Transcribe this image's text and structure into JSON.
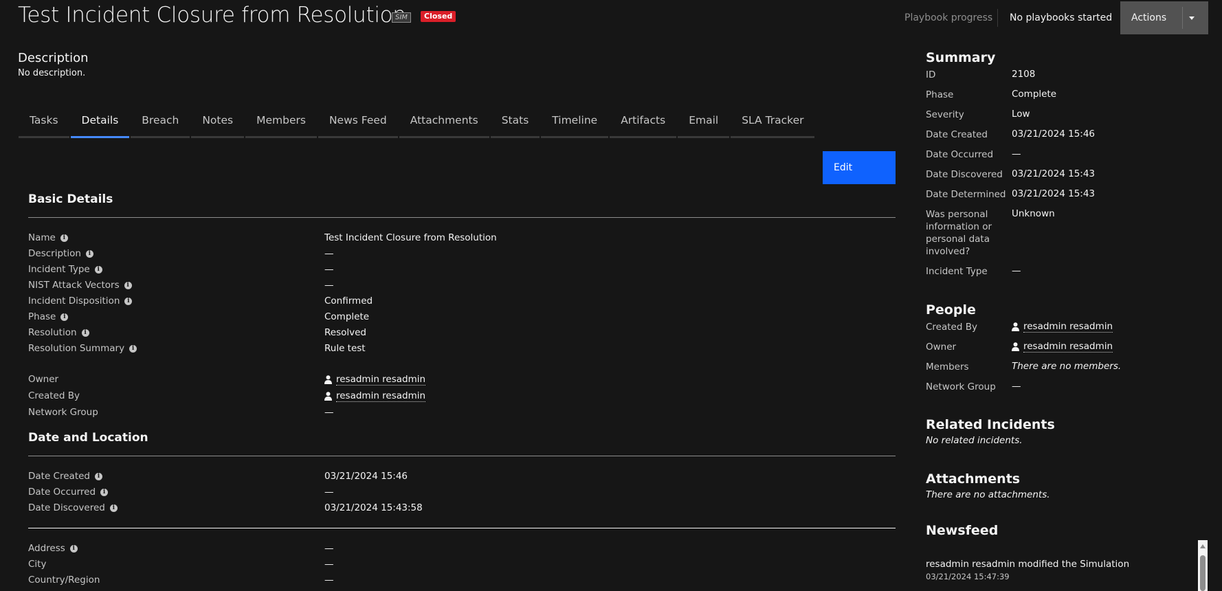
{
  "header": {
    "title": "Test Incident Closure from Resolution",
    "sim_badge": "SIM",
    "status_badge": "Closed",
    "playbook_label": "Playbook progress",
    "playbook_status": "No playbooks started",
    "actions_label": "Actions"
  },
  "description": {
    "heading": "Description",
    "value": "No description."
  },
  "tabs": [
    "Tasks",
    "Details",
    "Breach",
    "Notes",
    "Members",
    "News Feed",
    "Attachments",
    "Stats",
    "Timeline",
    "Artifacts",
    "Email",
    "SLA Tracker"
  ],
  "active_tab": "Details",
  "edit_label": "Edit",
  "basic": {
    "heading": "Basic Details",
    "rows": [
      {
        "label": "Name",
        "value": "Test Incident Closure from Resolution"
      },
      {
        "label": "Description",
        "value": "—"
      },
      {
        "label": "Incident Type",
        "value": "—"
      },
      {
        "label": "NIST Attack Vectors",
        "value": "—"
      },
      {
        "label": "Incident Disposition",
        "value": "Confirmed"
      },
      {
        "label": "Phase",
        "value": "Complete"
      },
      {
        "label": "Resolution",
        "value": "Resolved"
      },
      {
        "label": "Resolution Summary",
        "value": "Rule test"
      }
    ],
    "owner_label": "Owner",
    "owner": "resadmin resadmin",
    "created_by_label": "Created By",
    "created_by": "resadmin resadmin",
    "network_group_label": "Network Group",
    "network_group": "—"
  },
  "date_location": {
    "heading": "Date and Location",
    "rows": [
      {
        "label": "Date Created",
        "value": "03/21/2024 15:46"
      },
      {
        "label": "Date Occurred",
        "value": "—"
      },
      {
        "label": "Date Discovered",
        "value": "03/21/2024 15:43:58"
      }
    ],
    "loc_rows": [
      {
        "label": "Address",
        "value": "—"
      },
      {
        "label": "City",
        "value": "—"
      },
      {
        "label": "Country/Region",
        "value": "—"
      }
    ]
  },
  "summary": {
    "heading": "Summary",
    "rows": [
      {
        "label": "ID",
        "value": "2108"
      },
      {
        "label": "Phase",
        "value": "Complete"
      },
      {
        "label": "Severity",
        "value": "Low"
      },
      {
        "label": "Date Created",
        "value": "03/21/2024 15:46"
      },
      {
        "label": "Date Occurred",
        "value": "—"
      },
      {
        "label": "Date Discovered",
        "value": "03/21/2024 15:43"
      },
      {
        "label": "Date Determined",
        "value": "03/21/2024 15:43"
      },
      {
        "label": "Was personal information or personal data involved?",
        "value": "Unknown"
      },
      {
        "label": "Incident Type",
        "value": "—"
      }
    ]
  },
  "people": {
    "heading": "People",
    "created_by_label": "Created By",
    "created_by": "resadmin resadmin",
    "owner_label": "Owner",
    "owner": "resadmin resadmin",
    "members_label": "Members",
    "members": "There are no members.",
    "network_group_label": "Network Group",
    "network_group": "—"
  },
  "related": {
    "heading": "Related Incidents",
    "value": "No related incidents."
  },
  "attachments": {
    "heading": "Attachments",
    "value": "There are no attachments."
  },
  "newsfeed": {
    "heading": "Newsfeed",
    "item_text": "resadmin resadmin modified the Simulation",
    "item_time": "03/21/2024 15:47:39"
  },
  "colors": {
    "background": "#161616",
    "accent": "#0f62fe",
    "tab_active": "#4589ff",
    "closed_badge": "#da1e28"
  }
}
